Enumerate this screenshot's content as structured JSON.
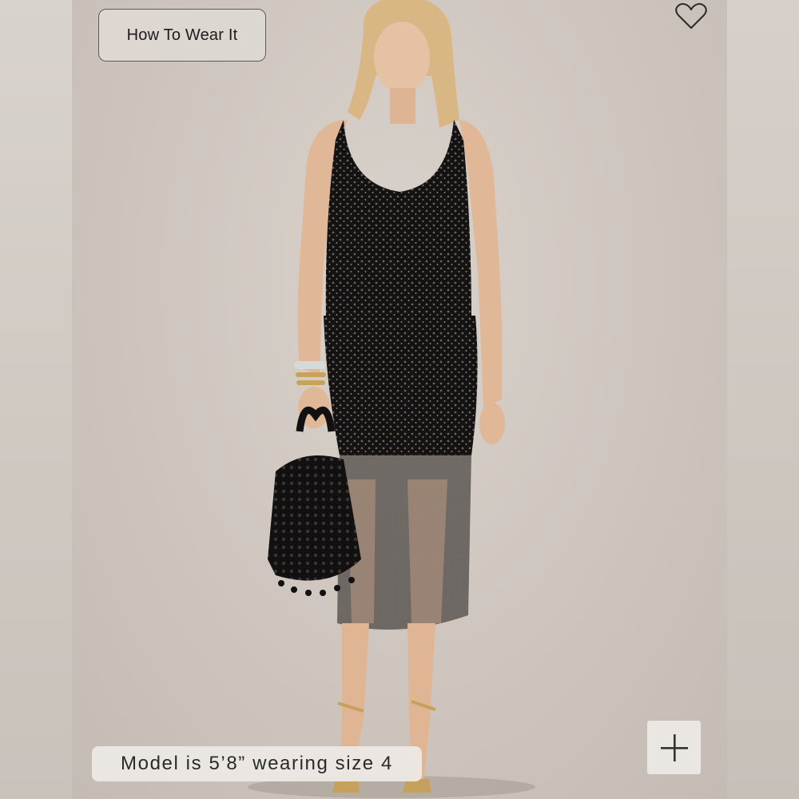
{
  "product_image": {
    "alt": "Model wearing black sequin tank top and sheer sequin midi skirt with black beaded bag and gold sandals"
  },
  "how_to_wear": {
    "label": "How To Wear It"
  },
  "wishlist": {
    "icon": "heart-outline-icon"
  },
  "zoom": {
    "icon": "plus-icon"
  },
  "model_info": {
    "text": "Model is 5’8” wearing size 4"
  },
  "colors": {
    "backdrop": "#cfc8c1",
    "garment": "#141212",
    "overlay": "#ece8e4"
  }
}
